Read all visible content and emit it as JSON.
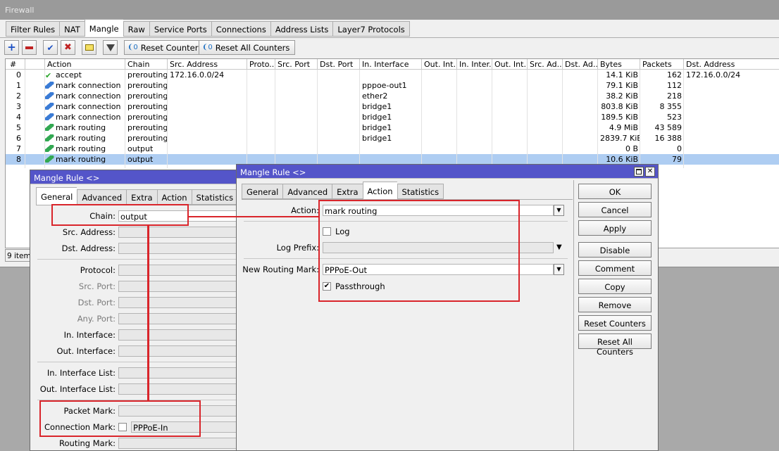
{
  "firewall": {
    "title": "Firewall",
    "tabs": [
      "Filter Rules",
      "NAT",
      "Mangle",
      "Raw",
      "Service Ports",
      "Connections",
      "Address Lists",
      "Layer7 Protocols"
    ],
    "active_tab": "Mangle",
    "toolbar": {
      "reset_counters": "Reset Counters",
      "reset_all_counters": "Reset All Counters"
    },
    "columns": [
      "#",
      "",
      "Action",
      "Chain",
      "Src. Address",
      "Proto...",
      "Src. Port",
      "Dst. Port",
      "In. Interface",
      "Out. Int...",
      "In. Inter...",
      "Out. Int...",
      "Src. Ad...",
      "Dst. Ad...",
      "Bytes",
      "Packets",
      "Dst. Address"
    ],
    "rows": [
      {
        "num": "0",
        "icon": "accept",
        "action": "accept",
        "chain": "prerouting",
        "src": "172.16.0.0/24",
        "in_if": "",
        "bytes": "14.1 KiB",
        "packets": "162",
        "dst": "172.16.0.0/24"
      },
      {
        "num": "1",
        "icon": "mark-connection",
        "action": "mark connection",
        "chain": "prerouting",
        "src": "",
        "in_if": "pppoe-out1",
        "bytes": "79.1 KiB",
        "packets": "112",
        "dst": ""
      },
      {
        "num": "2",
        "icon": "mark-connection",
        "action": "mark connection",
        "chain": "prerouting",
        "src": "",
        "in_if": "ether2",
        "bytes": "38.2 KiB",
        "packets": "218",
        "dst": ""
      },
      {
        "num": "3",
        "icon": "mark-connection",
        "action": "mark connection",
        "chain": "prerouting",
        "src": "",
        "in_if": "bridge1",
        "bytes": "803.8 KiB",
        "packets": "8 355",
        "dst": ""
      },
      {
        "num": "4",
        "icon": "mark-connection",
        "action": "mark connection",
        "chain": "prerouting",
        "src": "",
        "in_if": "bridge1",
        "bytes": "189.5 KiB",
        "packets": "523",
        "dst": ""
      },
      {
        "num": "5",
        "icon": "mark-routing",
        "action": "mark routing",
        "chain": "prerouting",
        "src": "",
        "in_if": "bridge1",
        "bytes": "4.9 MiB",
        "packets": "43 589",
        "dst": ""
      },
      {
        "num": "6",
        "icon": "mark-routing",
        "action": "mark routing",
        "chain": "prerouting",
        "src": "",
        "in_if": "bridge1",
        "bytes": "2839.7 KiB",
        "packets": "16 388",
        "dst": ""
      },
      {
        "num": "7",
        "icon": "mark-routing",
        "action": "mark routing",
        "chain": "output",
        "src": "",
        "in_if": "",
        "bytes": "0 B",
        "packets": "0",
        "dst": ""
      },
      {
        "num": "8",
        "icon": "mark-routing",
        "action": "mark routing",
        "chain": "output",
        "src": "",
        "in_if": "",
        "bytes": "10.6 KiB",
        "packets": "79",
        "dst": "",
        "selected": true
      }
    ],
    "status": "9 items"
  },
  "dialog_general": {
    "title": "Mangle Rule <>",
    "tabs": [
      "General",
      "Advanced",
      "Extra",
      "Action",
      "Statistics"
    ],
    "active_tab": "General",
    "fields": {
      "chain_label": "Chain:",
      "chain_value": "output",
      "src_address": "Src. Address:",
      "dst_address": "Dst. Address:",
      "protocol": "Protocol:",
      "src_port": "Src. Port:",
      "dst_port": "Dst. Port:",
      "any_port": "Any. Port:",
      "in_interface": "In. Interface:",
      "out_interface": "Out. Interface:",
      "in_interface_list": "In. Interface List:",
      "out_interface_list": "Out. Interface List:",
      "packet_mark": "Packet Mark:",
      "connection_mark_label": "Connection Mark:",
      "connection_mark_value": "PPPoE-In",
      "routing_mark": "Routing Mark:"
    }
  },
  "dialog_action": {
    "title": "Mangle Rule <>",
    "tabs": [
      "General",
      "Advanced",
      "Extra",
      "Action",
      "Statistics"
    ],
    "active_tab": "Action",
    "fields": {
      "action_label": "Action:",
      "action_value": "mark routing",
      "log_label": "Log",
      "log_prefix_label": "Log Prefix:",
      "new_routing_mark_label": "New Routing Mark:",
      "new_routing_mark_value": "PPPoE-Out",
      "passthrough_label": "Passthrough"
    },
    "buttons": [
      "OK",
      "Cancel",
      "Apply",
      "Disable",
      "Comment",
      "Copy",
      "Remove",
      "Reset Counters",
      "Reset All Counters"
    ]
  },
  "colors": {
    "highlight": "#d9252b",
    "selected_row": "#aecdf2",
    "accent": "#1c6fc2"
  }
}
